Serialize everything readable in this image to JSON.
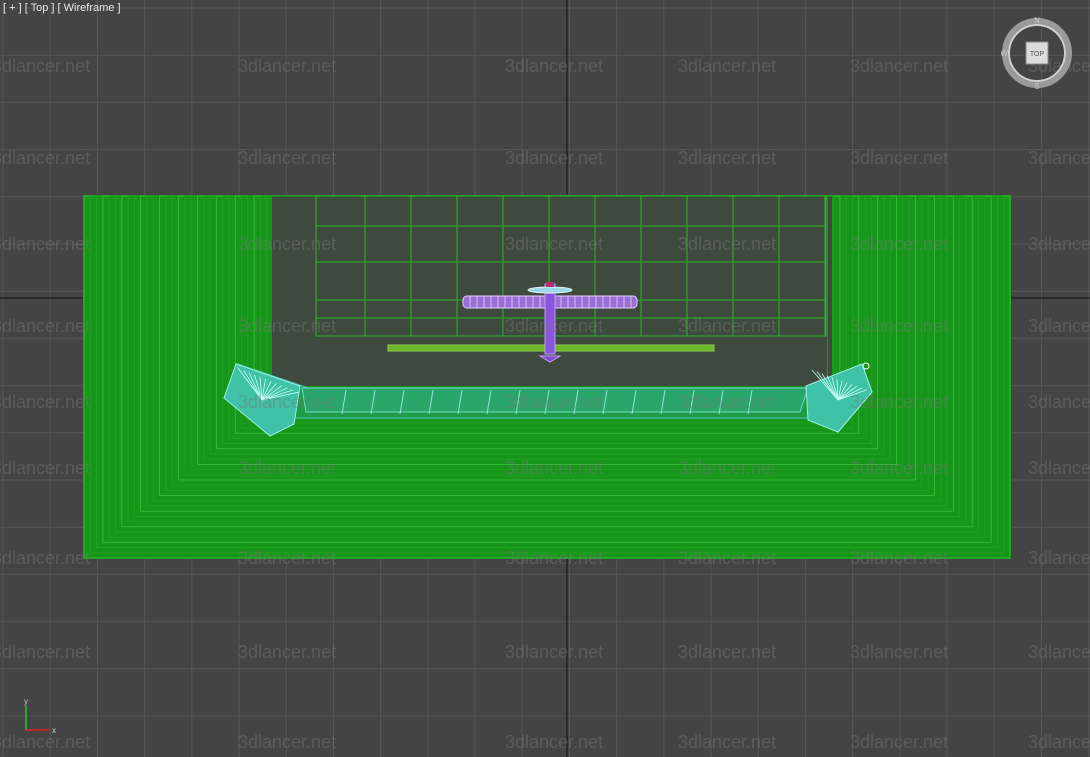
{
  "viewport": {
    "menu_label": "[ + ]",
    "view_label": "[ Top ]",
    "shading_label": "[ Wireframe ]"
  },
  "viewcube": {
    "face_label": "TOP",
    "north": "N",
    "south": "S",
    "west": "W"
  },
  "axis_gizmo": {
    "x_label": "x",
    "y_label": "y"
  },
  "watermark": {
    "text": "3dlancer.net"
  },
  "colors": {
    "background": "#444444",
    "grid_line": "#555555",
    "grid_axis": "#111111",
    "room_wire": "#22aa22",
    "room_dense": "#17961b",
    "sofa_wire": "#3fc2a8",
    "lamp_wire": "#c29bf0",
    "lamp_stem": "#8a55dd",
    "rug_wire": "#6ab52a"
  }
}
